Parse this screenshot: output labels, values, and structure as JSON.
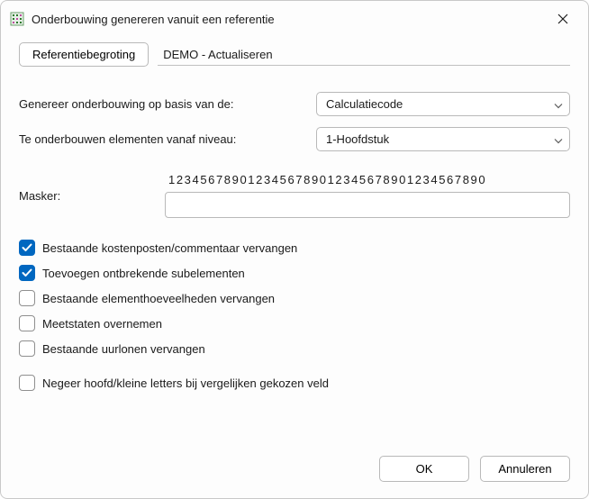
{
  "window": {
    "title": "Onderbouwing genereren vanuit een referentie"
  },
  "ref": {
    "button_label": "Referentiebegroting",
    "value": "DEMO - Actualiseren"
  },
  "fields": {
    "basis": {
      "label": "Genereer onderbouwing op basis van de:",
      "value": "Calculatiecode"
    },
    "niveau": {
      "label": "Te onderbouwen elementen vanaf niveau:",
      "value": "1-Hoofdstuk"
    }
  },
  "mask": {
    "label": "Masker:",
    "ruler": "1234567890123456789012345678901234567890",
    "value": ""
  },
  "checks": [
    {
      "label": "Bestaande kostenposten/commentaar vervangen",
      "checked": true,
      "gap": false
    },
    {
      "label": "Toevoegen ontbrekende subelementen",
      "checked": true,
      "gap": false
    },
    {
      "label": "Bestaande elementhoeveelheden vervangen",
      "checked": false,
      "gap": false
    },
    {
      "label": "Meetstaten overnemen",
      "checked": false,
      "gap": false
    },
    {
      "label": "Bestaande uurlonen vervangen",
      "checked": false,
      "gap": false
    },
    {
      "label": "Negeer hoofd/kleine letters bij vergelijken gekozen veld",
      "checked": false,
      "gap": true
    }
  ],
  "footer": {
    "ok": "OK",
    "cancel": "Annuleren"
  },
  "colors": {
    "accent": "#0067c0"
  }
}
